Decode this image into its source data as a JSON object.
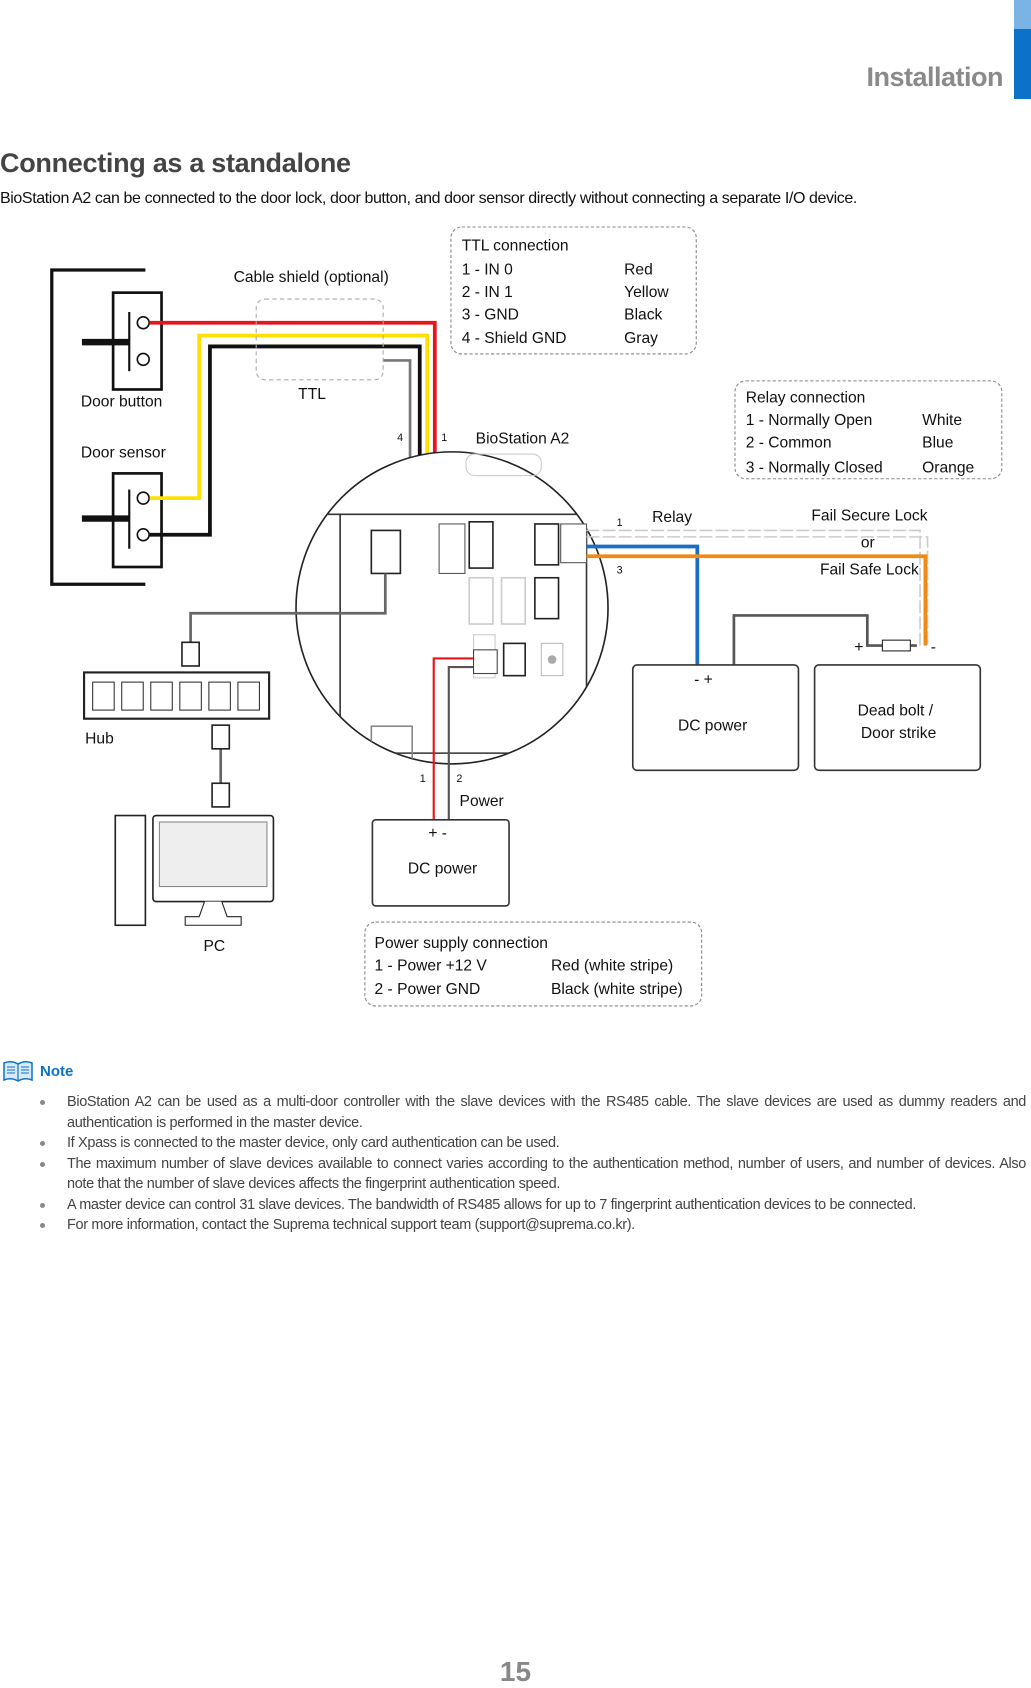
{
  "header": {
    "section": "Installation",
    "accent_color": "#0a72c8"
  },
  "page": {
    "title": "Connecting as a standalone",
    "intro": "BioStation A2 can be connected to the door lock, door button, and door sensor directly without connecting a separate I/O device.",
    "number": "15"
  },
  "diagram": {
    "labels": {
      "cable_shield": "Cable  shield  (optional)",
      "ttl": "TTL",
      "door_button": "Door  button",
      "door_sensor": "Door  sensor",
      "device": "BioStation  A2",
      "pin4": "4",
      "pin1": "1",
      "hub": "Hub",
      "pc": "PC",
      "relay": "Relay",
      "relay_pin1": "1",
      "relay_pin3": "3",
      "fail_secure": "Fail  Secure  Lock",
      "or": "or",
      "fail_safe": "Fail  Safe  Lock",
      "dc_power_right": "DC  power",
      "dc_minus_plus": "-      +",
      "deadbolt_1": "Dead  bolt  /",
      "deadbolt_2": "Door  strike",
      "lock_plus": "+",
      "lock_minus": "-",
      "power": "Power",
      "power_pin1": "1",
      "power_pin2": "2",
      "dc_power_bottom": "DC  power",
      "dc_plus_minus": "+  -"
    },
    "ttl_table": {
      "title": "TTL  connection",
      "rows": [
        {
          "pin": "1 -  IN  0",
          "color": "Red"
        },
        {
          "pin": "2 -  IN  1",
          "color": "Yellow"
        },
        {
          "pin": "3 -  GND",
          "color": "Black"
        },
        {
          "pin": "4 -  Shield  GND",
          "color": "Gray"
        }
      ]
    },
    "relay_table": {
      "title": "Relay  connection",
      "rows": [
        {
          "pin": "1 -  Normally  Open",
          "color": "White"
        },
        {
          "pin": "2 -  Common",
          "color": "Blue"
        },
        {
          "pin": "3 -  Normally  Closed",
          "color": "Orange"
        }
      ]
    },
    "power_table": {
      "title": "Power  supply  connection",
      "rows": [
        {
          "pin": "1 -  Power  +12  V",
          "color": "Red  (white  stripe)"
        },
        {
          "pin": "2 -  Power  GND",
          "color": "Black  (white  stripe)"
        }
      ]
    },
    "wire_colors": {
      "red": "#e8141b",
      "yellow": "#ffe000",
      "black": "#111111",
      "gray": "#777777",
      "blue": "#1a6fc4",
      "orange": "#f08a12"
    }
  },
  "note": {
    "label": "Note",
    "items": [
      "BioStation A2 can be used as a multi-door controller with the slave devices with the RS485 cable. The slave devices are used as dummy readers and authentication is performed in the master device.",
      "If Xpass is connected to the master device, only card authentication can be used.",
      "The maximum number of slave devices available to connect varies according to the authentication method, number of users, and number of devices. Also note that the number of slave devices affects the fingerprint authentication speed.",
      "A master device can control 31 slave devices. The bandwidth of RS485 allows for up to 7 fingerprint authentication devices to be connected.",
      "For more information, contact the Suprema technical support team (support@suprema.co.kr)."
    ]
  }
}
